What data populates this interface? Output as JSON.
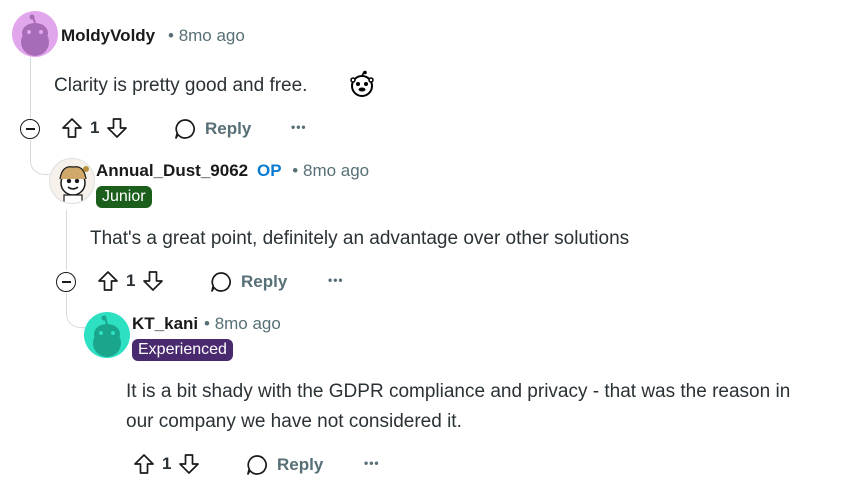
{
  "comments": [
    {
      "username": "MoldyVoldy",
      "age": "8mo ago",
      "body": "Clarity is pretty good and free.",
      "votes": "1",
      "reply_label": "Reply",
      "more_label": "•••",
      "avatar_color": "#e2a6ec"
    },
    {
      "username": "Annual_Dust_9062",
      "op_badge": "OP",
      "age": "8mo ago",
      "flair": "Junior",
      "flair_color": "#1c5e1c",
      "body": "That's a great point, definitely an advantage over other solutions",
      "votes": "1",
      "reply_label": "Reply",
      "more_label": "•••"
    },
    {
      "username": "KT_kani",
      "age": "8mo ago",
      "flair": "Experienced",
      "flair_color": "#4a2a6e",
      "body_line1": "It is a bit shady with the GDPR compliance and privacy - that was the reason in",
      "body_line2": "our company we have not considered it.",
      "votes": "1",
      "reply_label": "Reply",
      "more_label": "•••",
      "avatar_color": "#2de0c2"
    }
  ],
  "separator": "•"
}
